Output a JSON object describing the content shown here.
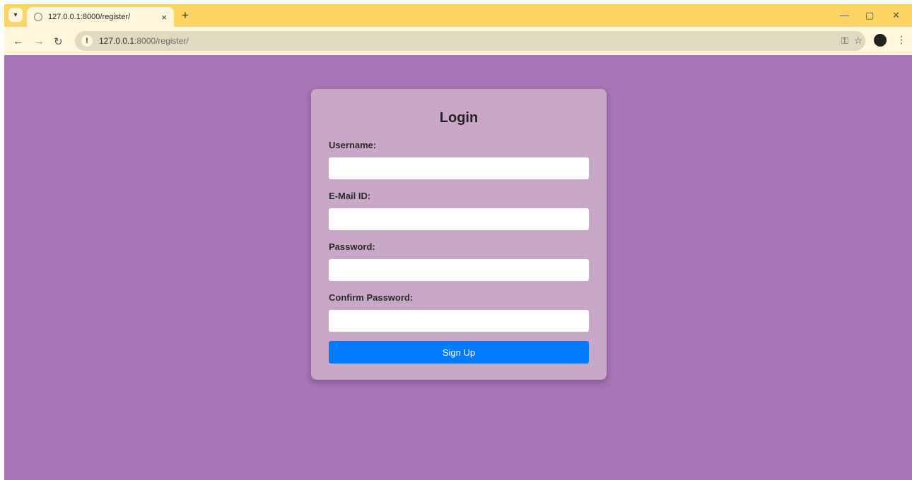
{
  "tab": {
    "title": "127.0.0.1:8000/register/",
    "close_glyph": "×",
    "new_tab_glyph": "+"
  },
  "omnibox": {
    "host": "127.0.0.1",
    "path": ":8000/register/"
  },
  "form": {
    "title": "Login",
    "fields": [
      {
        "label": "Username:",
        "value": ""
      },
      {
        "label": "E-Mail ID:",
        "value": ""
      },
      {
        "label": "Password:",
        "value": ""
      },
      {
        "label": "Confirm Password:",
        "value": ""
      }
    ],
    "submit_label": "Sign Up"
  },
  "colors": {
    "tabbar": "#fcd462",
    "toolbar": "#fff6dc",
    "page_background": "#a875b6",
    "card_background": "#c8a8c6",
    "submit_button": "#007bff"
  },
  "icons": [
    "tab-list-icon",
    "globe-icon",
    "close-icon",
    "plus-icon",
    "back-icon",
    "forward-icon",
    "reload-icon",
    "info-icon",
    "key-icon",
    "star-icon",
    "profile-icon",
    "menu-icon",
    "minimize-icon",
    "restore-icon",
    "window-close-icon"
  ]
}
